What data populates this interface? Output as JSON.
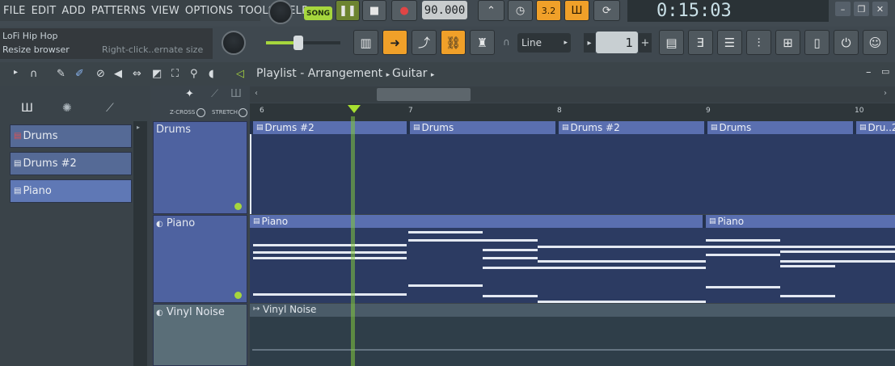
{
  "menu": [
    "FILE",
    "EDIT",
    "ADD",
    "PATTERNS",
    "VIEW",
    "OPTIONS",
    "TOOLS",
    "HELP"
  ],
  "transport": {
    "mode_label": "SONG",
    "tempo": "90.000",
    "time": "0:15:03"
  },
  "hint": {
    "line1": "LoFi Hip Hop",
    "line2": "Resize browser",
    "line3": "Right-click..ernate size"
  },
  "toolbar2": {
    "snap_mode": "Line",
    "step_value": "1"
  },
  "playlist": {
    "breadcrumb": [
      "Playlist",
      "Arrangement",
      "Guitar"
    ],
    "crossfade_label": "Z-CROSS",
    "stretch_label": "STRETCH",
    "bar_numbers": [
      "6",
      "7",
      "8",
      "9",
      "10"
    ]
  },
  "channels": [
    {
      "name": "Drums"
    },
    {
      "name": "Drums #2"
    },
    {
      "name": "Piano"
    }
  ],
  "tracks": [
    {
      "name": "Drums",
      "clips": [
        "Drums #2",
        "Drums",
        "Drums #2",
        "Drums",
        "Dru..2"
      ]
    },
    {
      "name": "Piano",
      "clips": [
        "Piano",
        "Piano"
      ]
    },
    {
      "name": "Vinyl Noise",
      "clips": [
        "Vinyl Noise"
      ]
    }
  ],
  "colors": {
    "accent_green": "#a6d63d",
    "accent_orange": "#f0a029",
    "clip_blue": "#5a6fb0",
    "lane_dark": "#24324e"
  }
}
